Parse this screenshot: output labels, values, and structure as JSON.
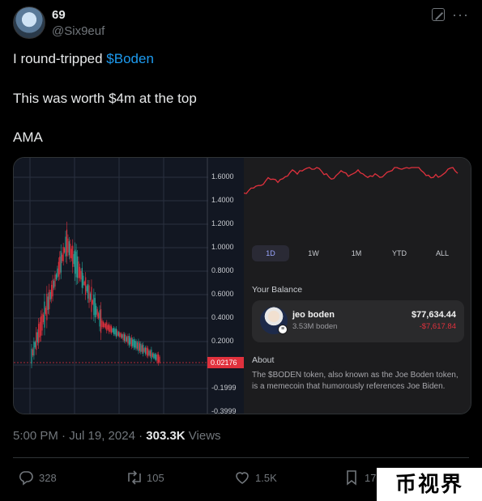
{
  "author": {
    "name": "69",
    "handle": "@Six9euf"
  },
  "tweet": {
    "line1_prefix": "I round-tripped ",
    "line1_link": "$Boden",
    "line2": "This was worth $4m at the top",
    "line3": "AMA"
  },
  "left_chart": {
    "y_ticks": [
      "1.6000",
      "1.4000",
      "1.2000",
      "1.0000",
      "0.8000",
      "0.6000",
      "0.4000",
      "0.2000",
      "-0.1999",
      "-0.3999"
    ],
    "current_price": "0.02176"
  },
  "right_panel": {
    "timeframes": [
      "1D",
      "1W",
      "1M",
      "YTD",
      "ALL"
    ],
    "active_timeframe": "1D",
    "balance_title": "Your Balance",
    "token_name": "jeo boden",
    "token_amount": "3.53M boden",
    "usd_value": "$77,634.44",
    "change": "-$7,617.84",
    "about_title": "About",
    "about_text": "The $BODEN token, also known as the Joe Boden token, is a memecoin that humorously references Joe Biden."
  },
  "meta": {
    "time": "5:00 PM · Jul 19, 2024 · ",
    "views_count": "303.3K",
    "views_label": " Views"
  },
  "actions": {
    "replies": "328",
    "reposts": "105",
    "likes": "1.5K",
    "bookmarks": "177"
  },
  "watermark": "币视界",
  "colors": {
    "accent": "#1d9bf0",
    "down": "#e0313d",
    "up": "#26a69a"
  }
}
